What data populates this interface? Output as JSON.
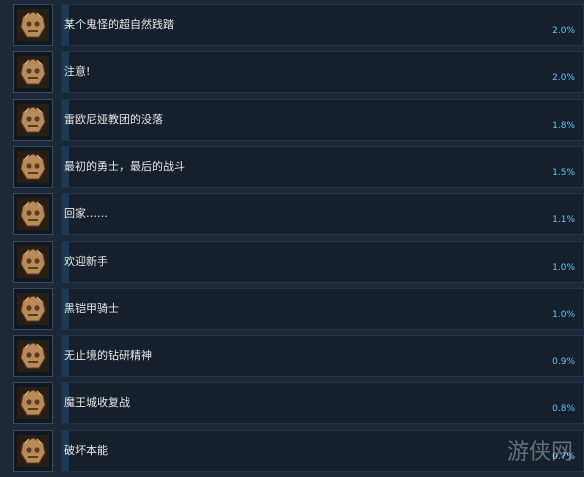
{
  "achievements": [
    {
      "name": "某个鬼怪的超自然践踏",
      "percent": "2.0%",
      "icon": "demon-mask-icon",
      "fill": 0.02
    },
    {
      "name": "注意!",
      "percent": "2.0%",
      "icon": "horned-skull-icon",
      "fill": 0.02
    },
    {
      "name": "雷欧尼娅教团的没落",
      "percent": "1.8%",
      "icon": "cathedral-icon",
      "fill": 0.018
    },
    {
      "name": "最初的勇士，最后的战斗",
      "percent": "1.5%",
      "icon": "warrior-icon",
      "fill": 0.015
    },
    {
      "name": "回家……",
      "percent": "1.1%",
      "icon": "knight-figure-icon",
      "fill": 0.011
    },
    {
      "name": "欢迎新手",
      "percent": "1.0%",
      "icon": "skull-icon",
      "fill": 0.01
    },
    {
      "name": "黑铠甲骑士",
      "percent": "1.0%",
      "icon": "armored-knight-icon",
      "fill": 0.01
    },
    {
      "name": "无止境的钻研精神",
      "percent": "0.9%",
      "icon": "muscle-torso-icon",
      "fill": 0.009
    },
    {
      "name": "魔王城收复战",
      "percent": "0.8%",
      "icon": "castle-icon",
      "fill": 0.008
    },
    {
      "name": "破坏本能",
      "percent": "0.7%",
      "icon": "beast-skull-icon",
      "fill": 0.007
    }
  ],
  "watermark": "游侠网",
  "colors": {
    "background": "#1b2838",
    "panel": "#16202d",
    "progress": "#1a3a56",
    "percent_text": "#66c0f4",
    "icon_bronze": "#b98a5a"
  }
}
